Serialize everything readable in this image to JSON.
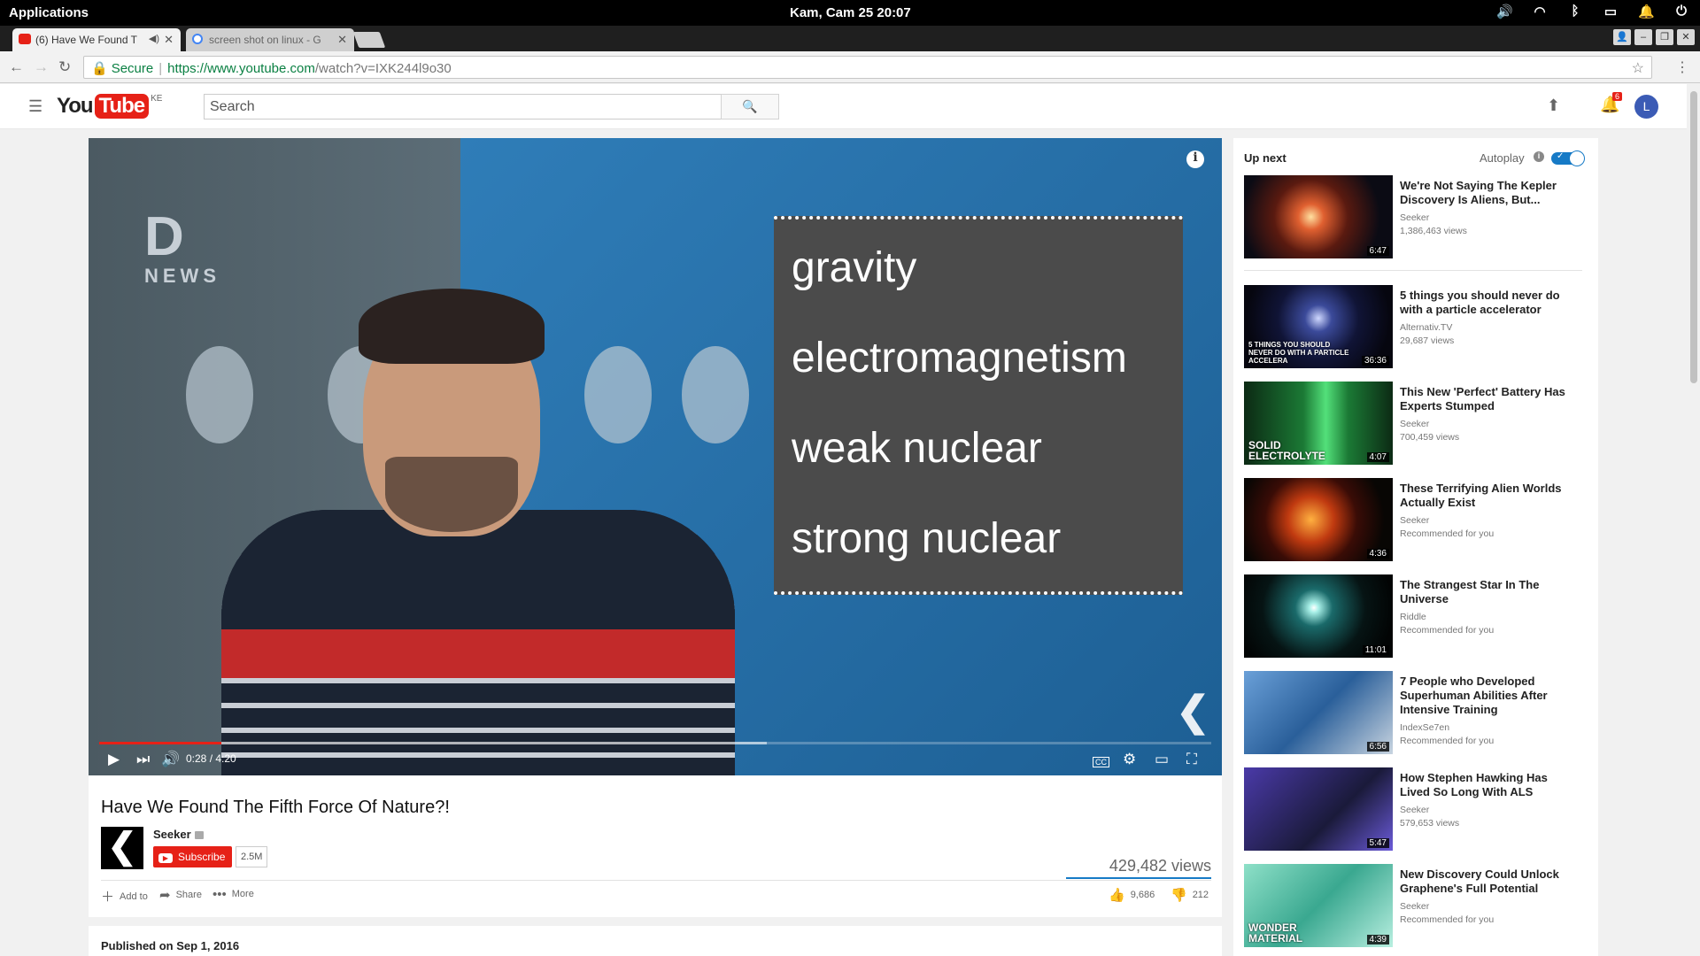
{
  "os_bar": {
    "apps_label": "Applications",
    "clock": "Kam, Cam 25   20:07",
    "tray_icons": [
      "volume-icon",
      "wifi-icon",
      "bluetooth-icon",
      "battery-icon",
      "bell-icon",
      "power-icon"
    ]
  },
  "browser": {
    "tabs": [
      {
        "label": "(6) Have We Found T",
        "favicon": "youtube",
        "active": true
      },
      {
        "label": "screen shot on linux - G",
        "favicon": "google",
        "active": false
      }
    ],
    "address": {
      "secure_label": "Secure",
      "url_host": "https://www.youtube.com",
      "url_path": "/watch?v=IXK244l9o30"
    }
  },
  "youtube": {
    "logo_you": "You",
    "logo_tube": "Tube",
    "region": "KE",
    "search_placeholder": "Search",
    "notification_count": "6",
    "avatar_letter": "L"
  },
  "video": {
    "forces": [
      "gravity",
      "electromagnetism",
      "weak nuclear",
      "strong nuclear"
    ],
    "brand_d": "D",
    "brand_news": "NEWS",
    "time_current": "0:28",
    "time_total": "4:20",
    "time_display": "0:28 / 4:20",
    "progress_fraction": 0.11,
    "buffered_fraction": 0.6,
    "title": "Have We Found The Fifth Force Of Nature?!",
    "channel": "Seeker",
    "subscribe_label": "Subscribe",
    "subscriber_count": "2.5M",
    "views": "429,482 views",
    "likes": "9,686",
    "dislikes": "212",
    "actions": {
      "add_to": "Add to",
      "share": "Share",
      "more": "More"
    },
    "published": "Published on Sep 1, 2016"
  },
  "sidebar": {
    "up_next_label": "Up next",
    "autoplay_label": "Autoplay",
    "items": [
      {
        "title": "We're Not Saying The Kepler Discovery Is Aliens, But...",
        "channel": "Seeker",
        "meta": "1,386,463 views",
        "duration": "6:47",
        "thumb_text": ""
      },
      {
        "title": "5 things you should never do with a particle accelerator",
        "channel": "Alternativ.TV",
        "meta": "29,687 views",
        "duration": "36:36",
        "thumb_text": "5 THINGS YOU SHOULD NEVER DO WITH A PARTICLE ACCELERA"
      },
      {
        "title": "This New 'Perfect' Battery Has Experts Stumped",
        "channel": "Seeker",
        "meta": "700,459 views",
        "duration": "4:07",
        "thumb_text": "SOLID ELECTROLYTE"
      },
      {
        "title": "These Terrifying Alien Worlds Actually Exist",
        "channel": "Seeker",
        "meta": "Recommended for you",
        "duration": "4:36",
        "thumb_text": ""
      },
      {
        "title": "The Strangest Star In The Universe",
        "channel": "Riddle",
        "meta": "Recommended for you",
        "duration": "11:01",
        "thumb_text": ""
      },
      {
        "title": "7 People who Developed Superhuman Abilities After Intensive Training",
        "channel": "IndexSe7en",
        "meta": "Recommended for you",
        "duration": "6:56",
        "thumb_text": ""
      },
      {
        "title": "How Stephen Hawking Has Lived So Long With ALS",
        "channel": "Seeker",
        "meta": "579,653 views",
        "duration": "5:47",
        "thumb_text": ""
      },
      {
        "title": "New Discovery Could Unlock Graphene's Full Potential",
        "channel": "Seeker",
        "meta": "Recommended for you",
        "duration": "4:39",
        "thumb_text": "WONDER MATERIAL"
      }
    ]
  }
}
